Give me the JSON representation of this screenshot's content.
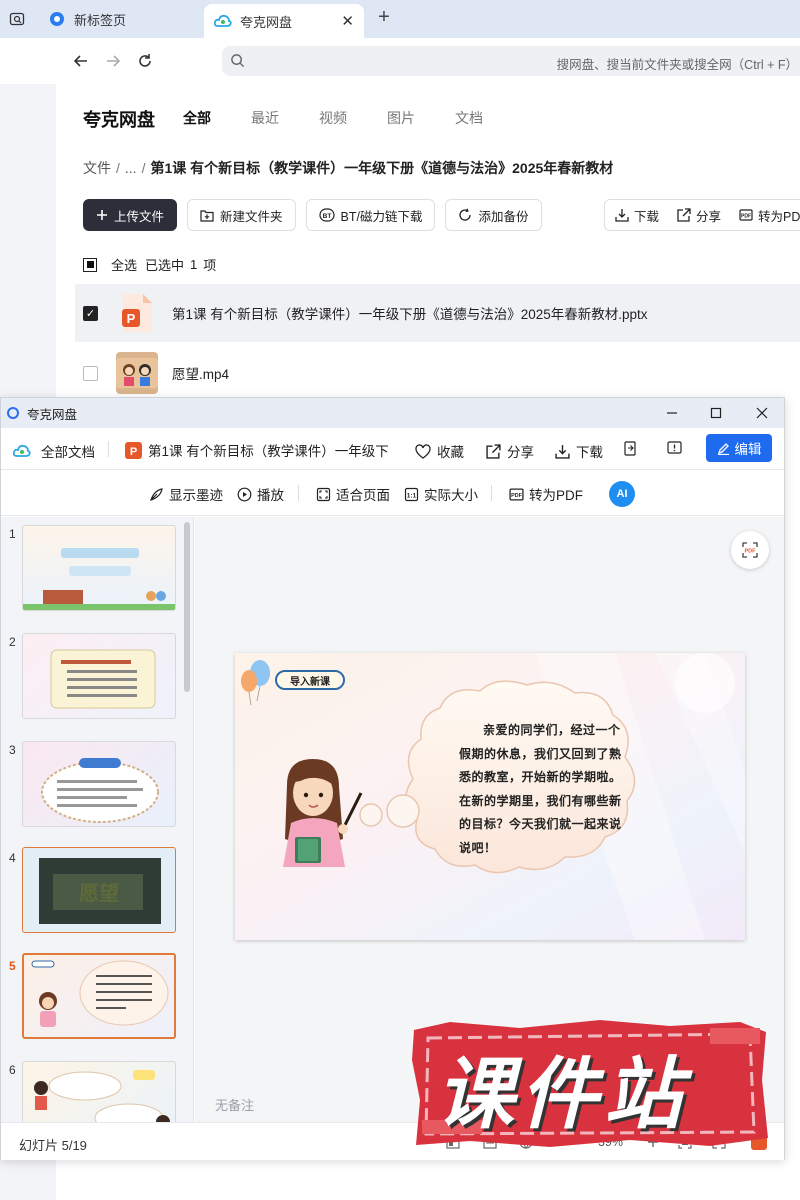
{
  "browser": {
    "tabs": [
      {
        "label": "新标签页",
        "active": false
      },
      {
        "label": "夸克网盘",
        "active": true
      }
    ],
    "address_placeholder": "搜网盘、搜当前文件夹或搜全网（Ctrl + F）"
  },
  "pan": {
    "title": "夸克网盘",
    "nav_tabs": [
      "全部",
      "最近",
      "视频",
      "图片",
      "文档"
    ],
    "breadcrumb": {
      "root": "文件",
      "ellipsis": "...",
      "current": "第1课 有个新目标（教学课件）一年级下册《道德与法治》2025年春新教材"
    },
    "toolbar": {
      "upload": "上传文件",
      "new_folder": "新建文件夹",
      "bt": "BT/磁力链下载",
      "backup": "添加备份"
    },
    "toolbar_right": {
      "download": "下载",
      "share": "分享",
      "to_pdf": "转为PDF"
    },
    "selection": {
      "select_all": "全选",
      "selected": "已选中",
      "count": "1",
      "unit": "项"
    },
    "files": [
      {
        "name": "第1课 有个新目标（教学课件）一年级下册《道德与法治》2025年春新教材.pptx",
        "selected": true,
        "type": "pptx"
      },
      {
        "name": "愿望.mp4",
        "selected": false,
        "type": "video"
      }
    ]
  },
  "viewer": {
    "window_title": "夸克网盘",
    "all_docs": "全部文档",
    "doc_title": "第1课 有个新目标（教学课件）一年级下",
    "favorite": "收藏",
    "share": "分享",
    "download": "下载",
    "edit": "编辑",
    "tools": {
      "show_ink": "显示墨迹",
      "play": "播放",
      "fit_page": "适合页面",
      "actual_size": "实际大小",
      "to_pdf": "转为PDF",
      "ai": "AI"
    },
    "thumbnails": [
      {
        "num": "1",
        "current": false
      },
      {
        "num": "2",
        "current": false
      },
      {
        "num": "3",
        "current": false
      },
      {
        "num": "4",
        "current": false
      },
      {
        "num": "5",
        "current": true
      },
      {
        "num": "6",
        "current": false
      }
    ],
    "slide": {
      "tag": "导入新课",
      "bubble_text": "亲爱的同学们，经过一个假期的休息，我们又回到了熟悉的教室，开始新的学期啦。在新的学期里，我们有哪些新的目标？今天我们就一起来说说吧！"
    },
    "notes": "无备注",
    "status": "幻灯片 5/19",
    "zoom": "39%"
  },
  "watermark": {
    "text": "课件站"
  },
  "colors": {
    "accent_blue": "#1e6bf0",
    "dark_button": "#2c2f3a",
    "current_thumb": "#e07a3a",
    "watermark_red": "#d9323f"
  }
}
